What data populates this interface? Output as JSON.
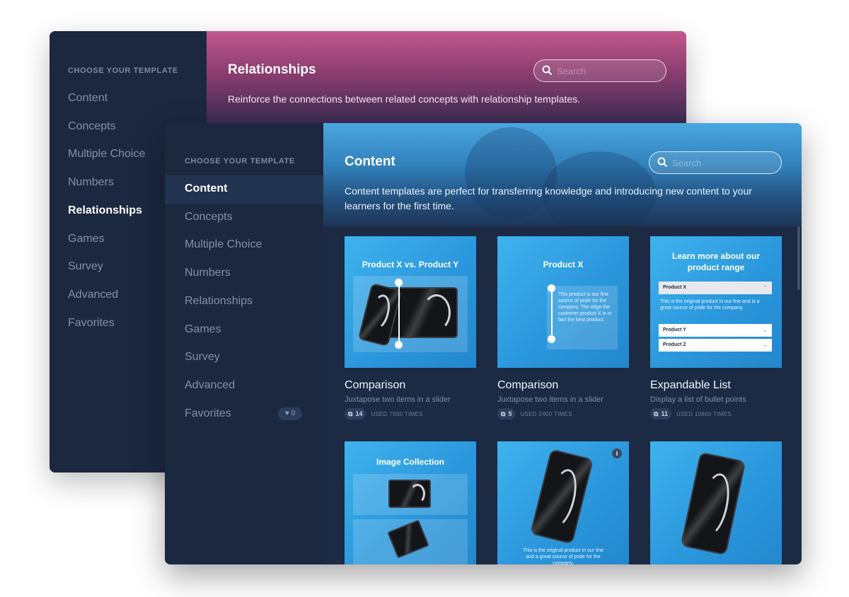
{
  "back_window": {
    "sidebar": {
      "heading": "CHOOSE YOUR TEMPLATE",
      "items": [
        {
          "label": "Content"
        },
        {
          "label": "Concepts"
        },
        {
          "label": "Multiple Choice"
        },
        {
          "label": "Numbers"
        },
        {
          "label": "Relationships",
          "active": true
        },
        {
          "label": "Games"
        },
        {
          "label": "Survey"
        },
        {
          "label": "Advanced"
        },
        {
          "label": "Favorites"
        }
      ]
    },
    "header": {
      "title": "Relationships",
      "description": "Reinforce the connections between related concepts with relationship templates.",
      "search_placeholder": "Search"
    }
  },
  "front_window": {
    "sidebar": {
      "heading": "CHOOSE YOUR TEMPLATE",
      "items": [
        {
          "label": "Content",
          "active": true
        },
        {
          "label": "Concepts"
        },
        {
          "label": "Multiple Choice"
        },
        {
          "label": "Numbers"
        },
        {
          "label": "Relationships"
        },
        {
          "label": "Games"
        },
        {
          "label": "Survey"
        },
        {
          "label": "Advanced"
        },
        {
          "label": "Favorites"
        }
      ],
      "favorites_badge": "♥ 0"
    },
    "header": {
      "title": "Content",
      "description": "Content templates are perfect for transferring knowledge and introducing new content to your learners for the first time.",
      "search_placeholder": "Search"
    },
    "cards": [
      {
        "thumb_title": "Product X vs. Product Y",
        "title": "Comparison",
        "subtitle": "Juxtapose two items in a slider",
        "count": "14",
        "used": "USED 7000 TIMES"
      },
      {
        "thumb_title": "Product X",
        "title": "Comparison",
        "subtitle": "Juxtapose two items in a slider",
        "count": "5",
        "used": "USED 2400 TIMES"
      },
      {
        "thumb_title": "Learn more about our product range",
        "title": "Expandable List",
        "subtitle": "Display a list of bullet points",
        "count": "11",
        "used": "USED 10600 TIMES",
        "list_rows": [
          "Product X",
          "Product Y",
          "Product Z"
        ],
        "list_text": "This is the original product in our line and is a great source of pride for the company."
      },
      {
        "thumb_title": "Image Collection"
      },
      {
        "info_icon": "i"
      },
      {}
    ],
    "thumb_small_text": {
      "slider_note": "This product is our first source of pride for the company. The edge the customer product X is in fact the best product.",
      "phone_note": "This is the original product in our line and a great source of pride for the company."
    }
  },
  "colors": {
    "sidebar_bg": "#1b2840",
    "accent_blue": "#2b97dc",
    "accent_pink": "#c2588c"
  }
}
